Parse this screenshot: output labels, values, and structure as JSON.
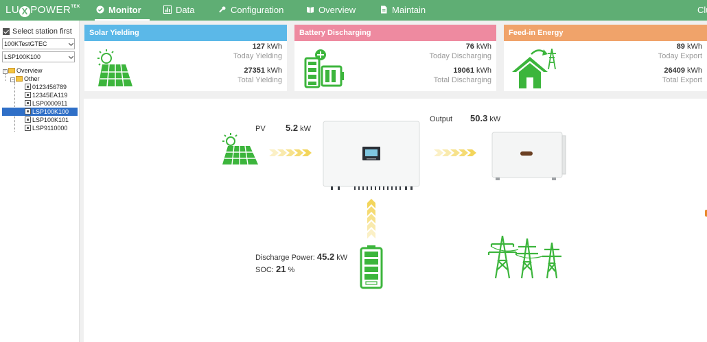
{
  "app": {
    "logo_text": "LUXPOWERTEK"
  },
  "nav": {
    "items": [
      {
        "label": "Monitor",
        "active": true
      },
      {
        "label": "Data"
      },
      {
        "label": "Configuration"
      },
      {
        "label": "Overview"
      },
      {
        "label": "Maintain"
      }
    ],
    "right_text": "Clu"
  },
  "sidebar": {
    "select_first_label": "Select station first",
    "station_select": "100KTestGTEC",
    "device_select": "LSP100K100",
    "tree": {
      "root": "Overview",
      "group": "Other",
      "devices": [
        "0123456789",
        "12345EA119",
        "LSP0000911",
        "LSP100K100",
        "LSP100K101",
        "LSP9110000"
      ],
      "selected": "LSP100K100"
    }
  },
  "cards": {
    "solar": {
      "title": "Solar Yielding",
      "today_value": "127",
      "today_unit": "kWh",
      "today_label": "Today Yielding",
      "total_value": "27351",
      "total_unit": "kWh",
      "total_label": "Total Yielding",
      "color": "#5bb8e8"
    },
    "battery": {
      "title": "Battery Discharging",
      "today_value": "76",
      "today_unit": "kWh",
      "today_label": "Today Discharging",
      "total_value": "19061",
      "total_unit": "kWh",
      "total_label": "Total Discharging",
      "color": "#ee8aa0"
    },
    "feedin": {
      "title": "Feed-in Energy",
      "today_value": "89",
      "today_unit": "kWh",
      "today_label": "Today Export",
      "total_value": "26409",
      "total_unit": "kWh",
      "total_label": "Total Export",
      "color": "#f0a36a"
    }
  },
  "flow": {
    "pv_label": "PV",
    "pv_value": "5.2",
    "pv_unit": "kW",
    "output_label": "Output",
    "output_value": "50.3",
    "output_unit": "kW",
    "discharge_label": "Discharge Power:",
    "discharge_value": "45.2",
    "discharge_unit": "kW",
    "soc_label": "SOC:",
    "soc_value": "21",
    "soc_unit": "%"
  },
  "colors": {
    "nav_green": "#5fae74",
    "icon_green": "#3cb53c",
    "arrow_yellow": "#f3d55b"
  }
}
